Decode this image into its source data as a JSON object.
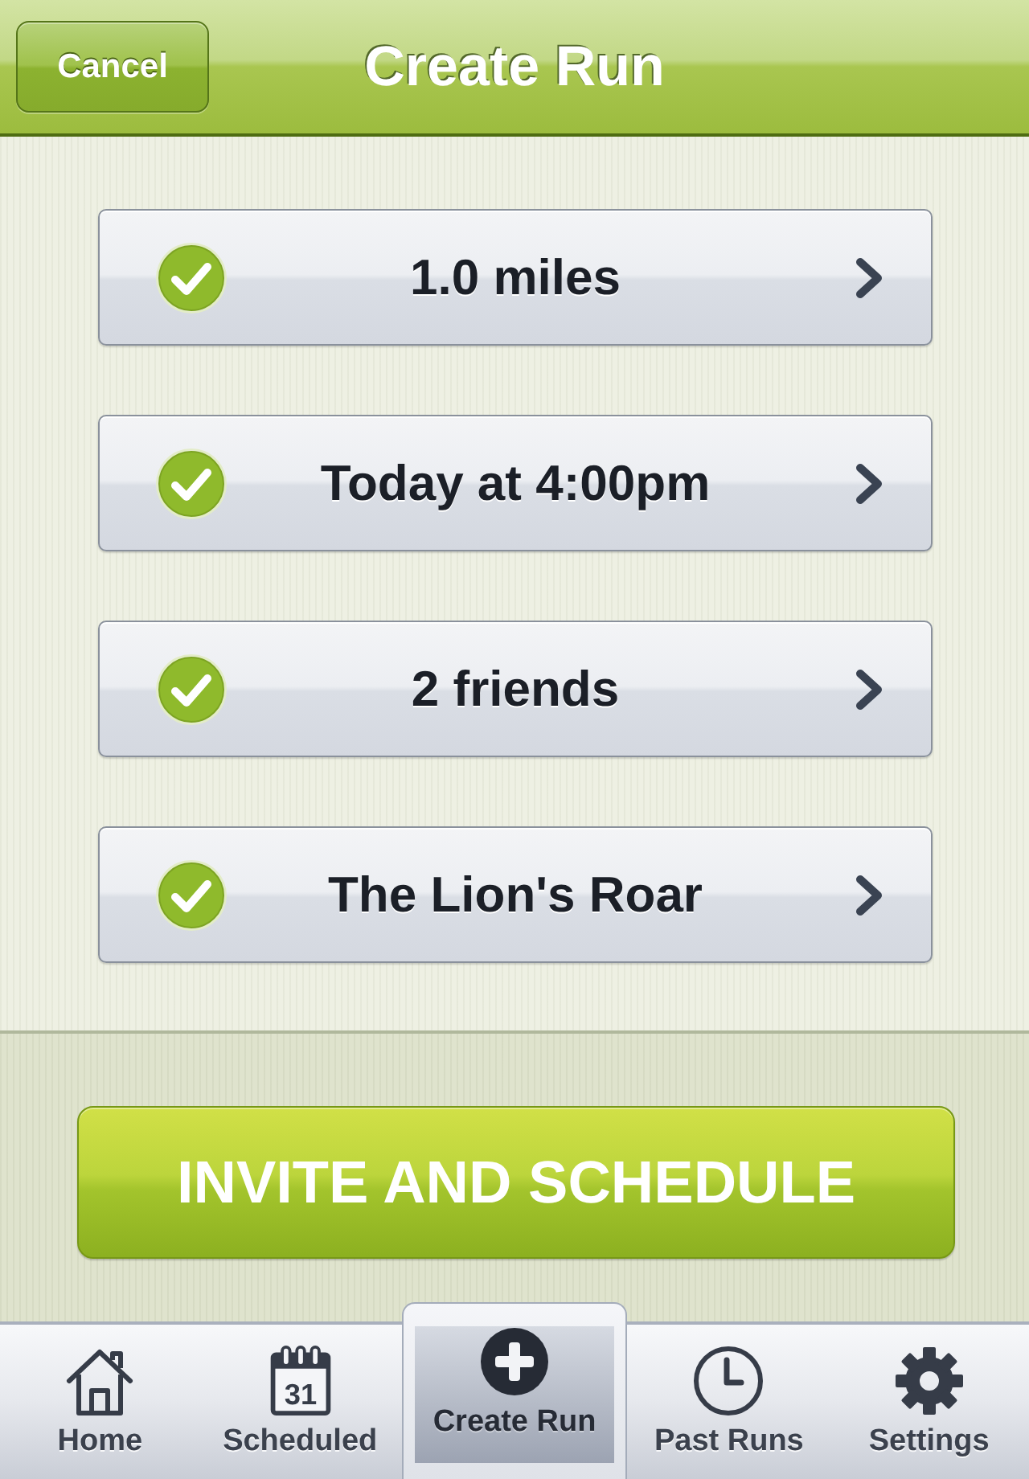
{
  "header": {
    "cancel_button": "Cancel",
    "title": "Create Run"
  },
  "rows": [
    {
      "label": "1.0 miles",
      "checked": true
    },
    {
      "label": "Today at 4:00pm",
      "checked": true
    },
    {
      "label": "2 friends",
      "checked": true
    },
    {
      "label": "The Lion's Roar",
      "checked": true
    }
  ],
  "primary_button": "INVITE AND SCHEDULE",
  "tab_bar": [
    {
      "label": "Home",
      "kind": "home",
      "selected": false
    },
    {
      "label": "Scheduled",
      "kind": "calendar",
      "day": "31",
      "selected": false
    },
    {
      "label": "Create Run",
      "kind": "add",
      "selected": true
    },
    {
      "label": "Past Runs",
      "kind": "clock",
      "selected": false
    },
    {
      "label": "Settings",
      "kind": "gear",
      "selected": false
    }
  ]
}
